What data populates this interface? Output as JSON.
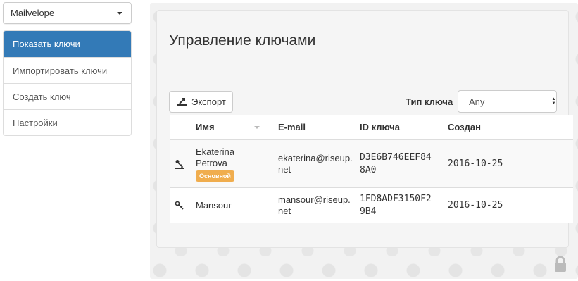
{
  "sidebar": {
    "keyring_select": "Mailvelope",
    "items": [
      {
        "label": "Показать ключи",
        "active": true
      },
      {
        "label": "Импортировать ключи",
        "active": false
      },
      {
        "label": "Создать ключ",
        "active": false
      },
      {
        "label": "Настройки",
        "active": false
      }
    ]
  },
  "main": {
    "title": "Управление ключами",
    "export_label": "Экспорт",
    "type_label": "Тип ключа",
    "type_value": "Any",
    "table": {
      "headers": {
        "name": "Имя",
        "email": "E-mail",
        "key_id": "ID ключа",
        "created": "Создан"
      },
      "rows": [
        {
          "icon": "keypair-icon",
          "name_line1": "Ekaterina",
          "name_line2": "Petrova",
          "badge": "Основной",
          "email_line1": "ekaterina@riseup.",
          "email_line2": "net",
          "key_id_line1": "D3E6B746EEF84",
          "key_id_line2": "8A0",
          "created": "2016-10-25"
        },
        {
          "icon": "public-key-icon",
          "name_line1": "Mansour",
          "email_line1": "mansour@riseup.",
          "email_line2": "net",
          "key_id_line1": "1FD8ADF3150F2",
          "key_id_line2": "9B4",
          "created": "2016-10-25"
        }
      ]
    }
  },
  "colors": {
    "active_nav": "#337ab7",
    "badge": "#f0ad4e"
  }
}
